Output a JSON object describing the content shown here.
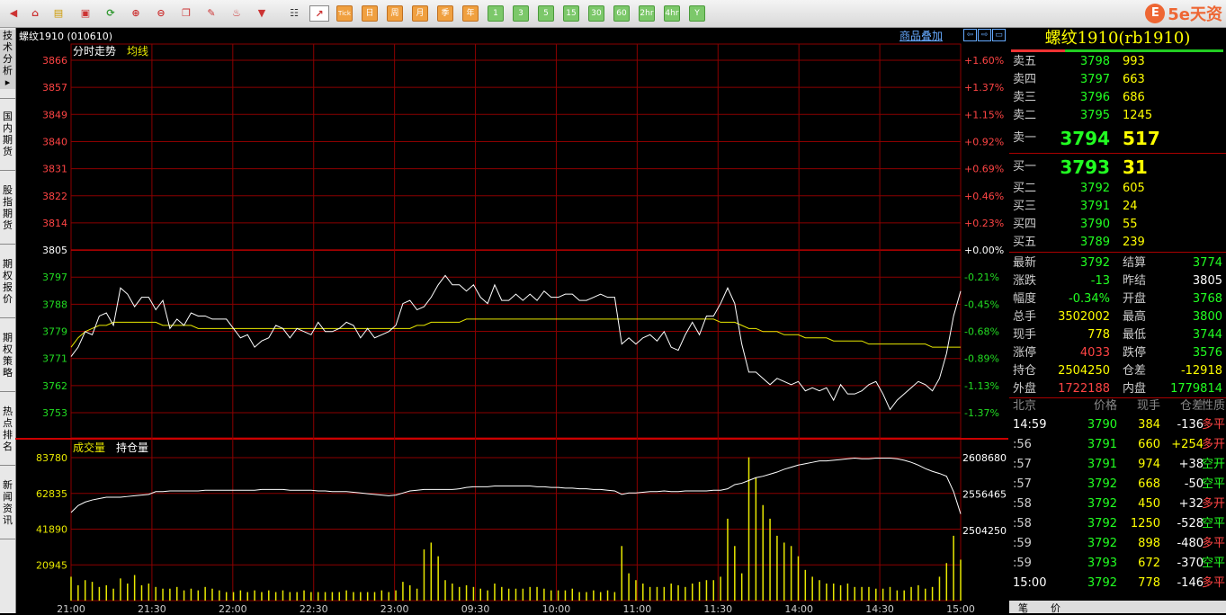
{
  "instrument": {
    "code": "螺纹1910 (010610)",
    "title": "螺纹1910(rb1910)"
  },
  "toolbar": {
    "periods": [
      "日",
      "周",
      "月",
      "季",
      "年",
      "1",
      "3",
      "5",
      "15",
      "30",
      "60",
      "2hr",
      "4hr",
      "Y"
    ],
    "tick_label": "Tick"
  },
  "sidebar": {
    "tabs": [
      "技术分析",
      "国内期货",
      "股指期货",
      "期权报价",
      "期权策略",
      "热点排名",
      "新闻资讯"
    ]
  },
  "chart": {
    "overlay_link": "商品叠加",
    "price_panel": {
      "legend": [
        "分时走势",
        "均线"
      ],
      "price_ticks": [
        "3866",
        "3857",
        "3849",
        "3840",
        "3831",
        "3822",
        "3814",
        "3805",
        "3797",
        "3788",
        "3779",
        "3771",
        "3762",
        "3753"
      ],
      "pct_ticks": [
        "+1.60%",
        "+1.37%",
        "+1.15%",
        "+0.92%",
        "+0.69%",
        "+0.46%",
        "+0.23%",
        "+0.00%",
        "-0.21%",
        "-0.45%",
        "-0.68%",
        "-0.89%",
        "-1.13%",
        "-1.37%"
      ]
    },
    "volume_panel": {
      "legend": [
        "成交量",
        "持仓量"
      ],
      "vol_ticks": [
        "83780",
        "62835",
        "41890",
        "20945"
      ],
      "oi_ticks": [
        "2608680",
        "2556465",
        "2504250"
      ]
    },
    "time_labels": [
      "21:00",
      "21:30",
      "22:00",
      "22:30",
      "23:00",
      "09:30",
      "10:00",
      "11:00",
      "11:30",
      "14:00",
      "14:30",
      "15:00"
    ],
    "colors": {
      "grid": "#8b0000",
      "price_line": "#ffffff",
      "avg_line": "#e8e800",
      "up": "#ff4444",
      "down": "#22dd22",
      "flat": "#ffffff",
      "volume": "#e8e800"
    }
  },
  "chart_data": {
    "type": "line",
    "x_label_ticks": [
      "21:00",
      "21:30",
      "22:00",
      "22:30",
      "23:00",
      "09:30",
      "10:00",
      "11:00",
      "11:30",
      "14:00",
      "14:30",
      "15:00"
    ],
    "prev_settle": 3805,
    "y_range": [
      3749,
      3870
    ],
    "price_series": [
      3771,
      3774,
      3779,
      3778,
      3784,
      3785,
      3781,
      3793,
      3791,
      3787,
      3790,
      3790,
      3786,
      3789,
      3780,
      3783,
      3781,
      3785,
      3784,
      3784,
      3783,
      3783,
      3783,
      3780,
      3777,
      3778,
      3774,
      3776,
      3777,
      3781,
      3780,
      3777,
      3780,
      3779,
      3778,
      3782,
      3779,
      3779,
      3780,
      3782,
      3781,
      3777,
      3780,
      3777,
      3778,
      3779,
      3781,
      3788,
      3789,
      3786,
      3787,
      3790,
      3794,
      3797,
      3794,
      3794,
      3792,
      3794,
      3790,
      3788,
      3794,
      3789,
      3789,
      3791,
      3789,
      3791,
      3789,
      3792,
      3790,
      3790,
      3791,
      3791,
      3789,
      3789,
      3790,
      3791,
      3790,
      3790,
      3775,
      3777,
      3775,
      3777,
      3778,
      3776,
      3779,
      3774,
      3773,
      3778,
      3782,
      3778,
      3784,
      3784,
      3788,
      3793,
      3788,
      3775,
      3766,
      3766,
      3764,
      3762,
      3764,
      3763,
      3762,
      3763,
      3760,
      3761,
      3760,
      3761,
      3757,
      3762,
      3759,
      3759,
      3760,
      3762,
      3763,
      3759,
      3754,
      3757,
      3759,
      3761,
      3763,
      3762,
      3760,
      3764,
      3772,
      3784,
      3792
    ],
    "avg_series": [
      3774,
      3777,
      3779,
      3780,
      3781,
      3781,
      3782,
      3782,
      3782,
      3782,
      3782,
      3782,
      3782,
      3781,
      3781,
      3781,
      3781,
      3781,
      3780,
      3780,
      3780,
      3780,
      3780,
      3780,
      3780,
      3780,
      3780,
      3780,
      3780,
      3780,
      3780,
      3780,
      3780,
      3780,
      3780,
      3780,
      3780,
      3780,
      3780,
      3780,
      3780,
      3780,
      3780,
      3780,
      3780,
      3780,
      3780,
      3780,
      3780,
      3781,
      3781,
      3782,
      3782,
      3782,
      3782,
      3782,
      3783,
      3783,
      3783,
      3783,
      3783,
      3783,
      3783,
      3783,
      3783,
      3783,
      3783,
      3783,
      3783,
      3783,
      3783,
      3783,
      3783,
      3783,
      3783,
      3783,
      3783,
      3783,
      3783,
      3783,
      3783,
      3783,
      3783,
      3783,
      3783,
      3783,
      3783,
      3783,
      3783,
      3783,
      3783,
      3783,
      3782,
      3782,
      3782,
      3781,
      3780,
      3780,
      3779,
      3779,
      3779,
      3778,
      3778,
      3778,
      3777,
      3777,
      3777,
      3777,
      3776,
      3776,
      3776,
      3776,
      3776,
      3775,
      3775,
      3775,
      3775,
      3775,
      3775,
      3775,
      3775,
      3775,
      3774,
      3774,
      3774,
      3774,
      3774
    ],
    "volume_series": [
      14000,
      9000,
      12000,
      11000,
      8000,
      9000,
      7000,
      13000,
      10000,
      15000,
      9000,
      10000,
      8000,
      7000,
      7000,
      8000,
      6000,
      7000,
      6000,
      8000,
      7000,
      6000,
      5000,
      5000,
      6000,
      5000,
      6000,
      5000,
      6000,
      5000,
      6000,
      5000,
      5000,
      6000,
      5000,
      5000,
      5000,
      5000,
      5000,
      6000,
      5000,
      5000,
      5000,
      5000,
      6000,
      5000,
      6000,
      11000,
      9000,
      7000,
      30000,
      34000,
      26000,
      12000,
      10000,
      8000,
      9000,
      8000,
      7000,
      6000,
      10000,
      8000,
      7000,
      7000,
      7000,
      8000,
      8000,
      7000,
      6000,
      6000,
      6000,
      7000,
      5000,
      5000,
      6000,
      5000,
      6000,
      5000,
      32000,
      16000,
      12000,
      10000,
      8000,
      8000,
      8000,
      10000,
      9000,
      8000,
      10000,
      11000,
      12000,
      12000,
      14000,
      48000,
      32000,
      16000,
      84000,
      72000,
      56000,
      48000,
      38000,
      34000,
      32000,
      26000,
      18000,
      14000,
      12000,
      10000,
      10000,
      9000,
      10000,
      8000,
      8000,
      8000,
      7000,
      7000,
      8000,
      6000,
      6000,
      8000,
      9000,
      7000,
      8000,
      14000,
      22000,
      38000,
      24000
    ],
    "oi_series": [
      2530000,
      2540000,
      2545000,
      2548000,
      2550000,
      2552000,
      2552000,
      2552000,
      2553000,
      2554000,
      2555000,
      2556000,
      2560000,
      2560000,
      2561000,
      2561000,
      2561000,
      2561000,
      2561000,
      2562000,
      2562000,
      2562000,
      2562000,
      2562000,
      2562000,
      2562000,
      2562000,
      2563000,
      2563000,
      2563000,
      2563000,
      2562000,
      2562000,
      2562000,
      2562000,
      2561000,
      2561000,
      2560000,
      2560000,
      2560000,
      2559000,
      2558000,
      2557000,
      2556000,
      2555000,
      2554000,
      2555000,
      2558000,
      2561000,
      2562000,
      2563000,
      2563000,
      2563000,
      2563000,
      2563000,
      2564000,
      2566000,
      2567000,
      2567000,
      2567000,
      2568000,
      2568000,
      2568000,
      2568000,
      2568000,
      2568000,
      2567000,
      2567000,
      2566000,
      2566000,
      2565000,
      2565000,
      2564000,
      2564000,
      2563000,
      2563000,
      2562000,
      2561000,
      2556000,
      2558000,
      2558000,
      2559000,
      2560000,
      2560000,
      2561000,
      2560000,
      2560000,
      2561000,
      2561000,
      2561000,
      2561000,
      2562000,
      2562000,
      2564000,
      2570000,
      2572000,
      2576000,
      2580000,
      2582000,
      2585000,
      2588000,
      2592000,
      2595000,
      2598000,
      2600000,
      2602000,
      2604000,
      2604000,
      2605000,
      2606000,
      2607000,
      2608000,
      2607000,
      2607000,
      2608000,
      2608000,
      2608000,
      2607000,
      2605000,
      2602000,
      2598000,
      2593000,
      2589000,
      2586000,
      2582000,
      2560000,
      2528000
    ],
    "vol_range": [
      0,
      83780
    ],
    "oi_range": [
      2504250,
      2608680
    ]
  },
  "quote": {
    "asks": [
      {
        "label": "卖五",
        "price": "3798",
        "vol": "993"
      },
      {
        "label": "卖四",
        "price": "3797",
        "vol": "663"
      },
      {
        "label": "卖三",
        "price": "3796",
        "vol": "686"
      },
      {
        "label": "卖二",
        "price": "3795",
        "vol": "1245"
      },
      {
        "label": "卖一",
        "price": "3794",
        "vol": "517"
      }
    ],
    "bids": [
      {
        "label": "买一",
        "price": "3793",
        "vol": "31"
      },
      {
        "label": "买二",
        "price": "3792",
        "vol": "605"
      },
      {
        "label": "买三",
        "price": "3791",
        "vol": "24"
      },
      {
        "label": "买四",
        "price": "3790",
        "vol": "55"
      },
      {
        "label": "买五",
        "price": "3789",
        "vol": "239"
      }
    ],
    "stats": [
      {
        "l1": "最新",
        "v1": "3792",
        "c1": "green",
        "l2": "结算",
        "v2": "3774",
        "c2": "green"
      },
      {
        "l1": "涨跌",
        "v1": "-13",
        "c1": "green",
        "l2": "昨结",
        "v2": "3805",
        "c2": "white"
      },
      {
        "l1": "幅度",
        "v1": "-0.34%",
        "c1": "green",
        "l2": "开盘",
        "v2": "3768",
        "c2": "green"
      },
      {
        "l1": "总手",
        "v1": "3502002",
        "c1": "yellow",
        "l2": "最高",
        "v2": "3800",
        "c2": "green"
      },
      {
        "l1": "现手",
        "v1": "778",
        "c1": "yellow",
        "l2": "最低",
        "v2": "3744",
        "c2": "green"
      },
      {
        "l1": "涨停",
        "v1": "4033",
        "c1": "red",
        "l2": "跌停",
        "v2": "3576",
        "c2": "green"
      },
      {
        "l1": "持仓",
        "v1": "2504250",
        "c1": "yellow",
        "l2": "仓差",
        "v2": "-12918",
        "c2": "yellow"
      },
      {
        "l1": "外盘",
        "v1": "1722188",
        "c1": "red",
        "l2": "内盘",
        "v2": "1779814",
        "c2": "green"
      }
    ],
    "ticks_header": [
      "北京",
      "价格",
      "现手",
      "仓差",
      "性质"
    ],
    "ticks": [
      {
        "time": "14:59",
        "price": "3790",
        "vol": "384",
        "chg": "-136",
        "nature": "多平",
        "pc": "green",
        "cc": "white",
        "nc": "red"
      },
      {
        "time": ":56",
        "price": "3791",
        "vol": "660",
        "chg": "+254",
        "nature": "多开",
        "pc": "green",
        "cc": "yellow",
        "nc": "red"
      },
      {
        "time": ":57",
        "price": "3791",
        "vol": "974",
        "chg": "+38",
        "nature": "空开",
        "pc": "green",
        "cc": "white",
        "nc": "green"
      },
      {
        "time": ":57",
        "price": "3792",
        "vol": "668",
        "chg": "-50",
        "nature": "空平",
        "pc": "green",
        "cc": "white",
        "nc": "green"
      },
      {
        "time": ":58",
        "price": "3792",
        "vol": "450",
        "chg": "+32",
        "nature": "多开",
        "pc": "green",
        "cc": "white",
        "nc": "red"
      },
      {
        "time": ":58",
        "price": "3792",
        "vol": "1250",
        "chg": "-528",
        "nature": "空平",
        "pc": "green",
        "cc": "white",
        "nc": "green"
      },
      {
        "time": ":59",
        "price": "3792",
        "vol": "898",
        "chg": "-480",
        "nature": "多平",
        "pc": "green",
        "cc": "white",
        "nc": "red"
      },
      {
        "time": ":59",
        "price": "3793",
        "vol": "672",
        "chg": "-370",
        "nature": "空平",
        "pc": "green",
        "cc": "white",
        "nc": "green"
      },
      {
        "time": "15:00",
        "price": "3792",
        "vol": "778",
        "chg": "-146",
        "nature": "多平",
        "pc": "green",
        "cc": "white",
        "nc": "red"
      }
    ],
    "bottom_tabs": [
      "笔",
      "价"
    ]
  },
  "logo": {
    "badge": "E",
    "text": "5e天资"
  }
}
